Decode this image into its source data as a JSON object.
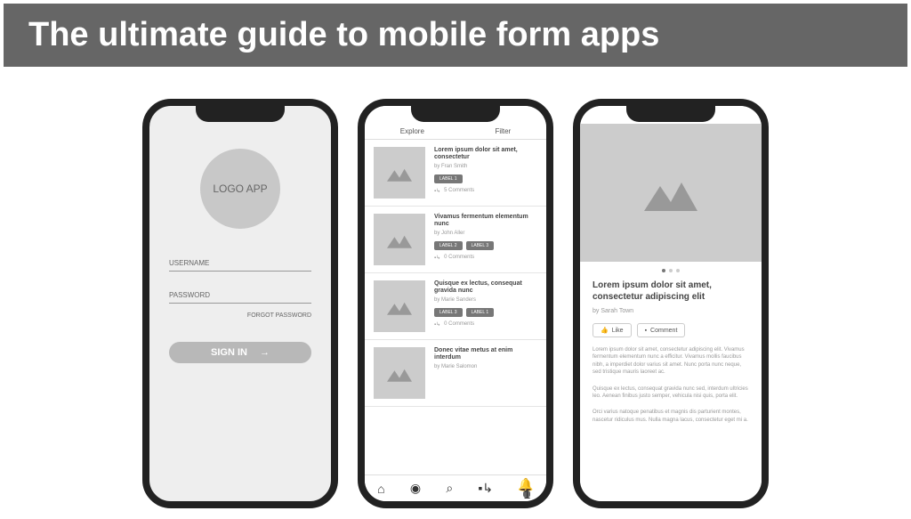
{
  "banner": {
    "title": "The ultimate guide to mobile form apps"
  },
  "phone1": {
    "logo_text": "LOGO APP",
    "username_label": "USERNAME",
    "password_label": "PASSWORD",
    "forgot_label": "FORGOT PASSWORD",
    "signin_label": "SIGN IN",
    "signin_arrow": "→"
  },
  "phone2": {
    "tab_explore": "Explore",
    "tab_filter": "Filter",
    "cards": [
      {
        "title": "Lorem ipsum dolor sit amet, consectetur",
        "by": "by Fran Smith",
        "tags": [
          "LABEL 1"
        ],
        "comments": "5 Comments"
      },
      {
        "title": "Vivamus fermentum elementum nunc",
        "by": "by John Aller",
        "tags": [
          "LABEL 2",
          "LABEL 3"
        ],
        "comments": "0 Comments"
      },
      {
        "title": "Quisque ex lectus, consequat gravida nunc",
        "by": "by Marie Sanders",
        "tags": [
          "LABEL 3",
          "LABEL 1"
        ],
        "comments": "0 Comments"
      },
      {
        "title": "Donec vitae metus at enim interdum",
        "by": "by Marie Salomon",
        "tags": [],
        "comments": ""
      }
    ],
    "nav_badge": "1"
  },
  "phone3": {
    "title": "Lorem ipsum dolor sit amet, consectetur adipiscing elit",
    "by": "by Sarah Town",
    "like_label": "Like",
    "comment_label": "Comment",
    "para1": "Lorem ipsum dolor sit amet, consectetur adipiscing elit. Vivamus fermentum elementum nunc a efficitur. Vivamus mollis faucibus nibh, a imperdiet dolor varius sit amet. Nunc porta nunc neque, sed tristique mauris laoreet ac.",
    "para2": "Quisque ex lectus, consequat gravida nunc sed, interdum ultricies leo. Aenean finibus justo semper, vehicula nisi quis, porta elit.",
    "para3": "Orci varius natoque penatibus et magnis dis parturient montes, nascetur ridiculus mus. Nulla magna lacus, consectetur eget mi a."
  }
}
